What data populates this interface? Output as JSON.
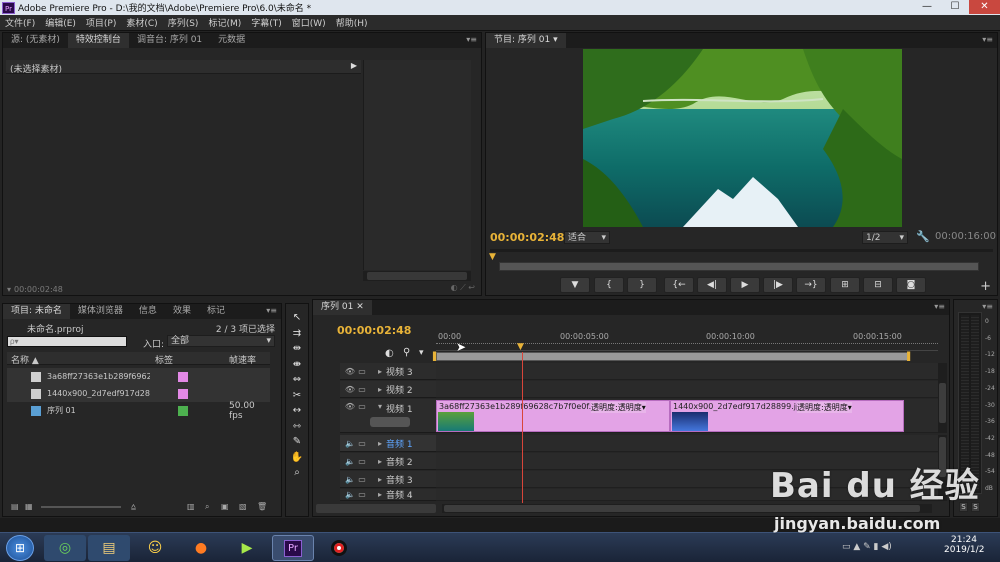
{
  "window": {
    "title": "Adobe Premiere Pro - D:\\我的文档\\Adobe\\Premiere Pro\\6.0\\未命名 *",
    "logo": "Pr"
  },
  "menu": [
    "文件(F)",
    "编辑(E)",
    "项目(P)",
    "素材(C)",
    "序列(S)",
    "标记(M)",
    "字幕(T)",
    "窗口(W)",
    "帮助(H)"
  ],
  "source_panel": {
    "tabs": [
      "源: (无素材)",
      "特效控制台",
      "调音台: 序列 01",
      "元数据"
    ],
    "active_tab": 1,
    "no_clip": "(未选择素材)",
    "timecode": "00:00:02:48"
  },
  "program_panel": {
    "tab": "节目: 序列 01",
    "timecode": "00:00:02:48",
    "fit": "适合",
    "resolution": "1/2",
    "duration": "00:00:16:00"
  },
  "project_panel": {
    "tabs": [
      "项目: 未命名",
      "媒体浏览器",
      "信息",
      "效果",
      "标记"
    ],
    "project_file": "未命名.prproj",
    "selection_count": "2 / 3 项已选择",
    "search_placeholder": "ρ▾",
    "in_label": "入口:",
    "in_value": "全部",
    "columns": {
      "name": "名称",
      "label": "标签",
      "fps": "帧速率"
    },
    "items": [
      {
        "name": "3a68ff27363e1b289f69628c",
        "color": "#e389e6",
        "fps": ""
      },
      {
        "name": "1440x900_2d7edf917d28899",
        "color": "#e389e6",
        "fps": ""
      },
      {
        "name": "序列 01",
        "color": "#4db14f",
        "fps": "50.00 fps"
      }
    ]
  },
  "timeline": {
    "tab": "序列 01",
    "timecode": "00:00:02:48",
    "ruler": [
      "00:00",
      "00:00:05:00",
      "00:00:10:00",
      "00:00:15:00"
    ],
    "video_tracks": [
      "视频 3",
      "视频 2",
      "视频 1"
    ],
    "audio_tracks": [
      "音频 1",
      "音频 2",
      "音频 3",
      "音频 4"
    ],
    "clips": [
      {
        "name": "3a68ff27363e1b289f69628c7b7f0e0f.jpg",
        "effect": "透明度:透明度▾"
      },
      {
        "name": "1440x900_2d7edf917d28899.jpg",
        "effect": "透明度:透明度▾"
      }
    ]
  },
  "meter": {
    "labels": [
      "0",
      "-6",
      "-12",
      "-18",
      "-24",
      "-30",
      "-36",
      "-42",
      "-48",
      "-54",
      "dB"
    ],
    "solo": "S"
  },
  "taskbar": {
    "time": "21:24",
    "date": "2019/1/2"
  },
  "watermark": {
    "brand": "Bai du 经验",
    "url": "jingyan.baidu.com"
  }
}
